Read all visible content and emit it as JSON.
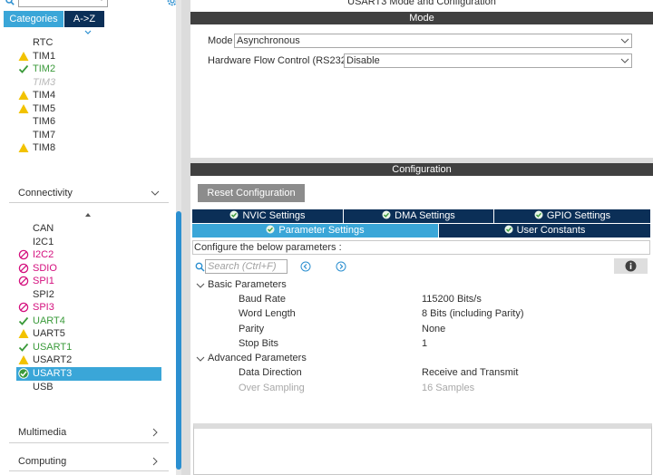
{
  "left": {
    "tabs": {
      "categories": "Categories",
      "az": "A->Z"
    },
    "timers": [
      {
        "label": "RTC",
        "status": "none"
      },
      {
        "label": "TIM1",
        "status": "warning"
      },
      {
        "label": "TIM2",
        "status": "ok"
      },
      {
        "label": "TIM3",
        "status": "disabled"
      },
      {
        "label": "TIM4",
        "status": "warning"
      },
      {
        "label": "TIM5",
        "status": "warning"
      },
      {
        "label": "TIM6",
        "status": "none"
      },
      {
        "label": "TIM7",
        "status": "none"
      },
      {
        "label": "TIM8",
        "status": "warning"
      }
    ],
    "connectivity": {
      "title": "Connectivity",
      "items": [
        {
          "label": "CAN",
          "status": "none"
        },
        {
          "label": "I2C1",
          "status": "none"
        },
        {
          "label": "I2C2",
          "status": "blocked"
        },
        {
          "label": "SDIO",
          "status": "blocked"
        },
        {
          "label": "SPI1",
          "status": "blocked"
        },
        {
          "label": "SPI2",
          "status": "none"
        },
        {
          "label": "SPI3",
          "status": "blocked"
        },
        {
          "label": "UART4",
          "status": "ok"
        },
        {
          "label": "UART5",
          "status": "warning"
        },
        {
          "label": "USART1",
          "status": "ok"
        },
        {
          "label": "USART2",
          "status": "warning"
        },
        {
          "label": "USART3",
          "status": "selected"
        },
        {
          "label": "USB",
          "status": "none"
        }
      ]
    },
    "multimedia": {
      "title": "Multimedia"
    },
    "computing": {
      "title": "Computing"
    }
  },
  "right": {
    "title": "USART3 Mode and Configuration",
    "mode_header": "Mode",
    "mode_label": "Mode",
    "mode_value": "Asynchronous",
    "hwflow_label": "Hardware Flow Control (RS232)",
    "hwflow_value": "Disable",
    "config_header": "Configuration",
    "reset_button": "Reset Configuration",
    "tabs": {
      "nvic": "NVIC Settings",
      "dma": "DMA Settings",
      "gpio": "GPIO Settings",
      "params": "Parameter Settings",
      "user": "User Constants"
    },
    "hint": "Configure the below parameters :",
    "search_placeholder": "Search (Ctrl+F)",
    "basic": {
      "title": "Basic Parameters",
      "rows": [
        {
          "name": "Baud Rate",
          "value": "115200 Bits/s"
        },
        {
          "name": "Word Length",
          "value": "8 Bits (including Parity)"
        },
        {
          "name": "Parity",
          "value": "None"
        },
        {
          "name": "Stop Bits",
          "value": "1"
        }
      ]
    },
    "advanced": {
      "title": "Advanced Parameters",
      "rows": [
        {
          "name": "Data Direction",
          "value": "Receive and Transmit"
        },
        {
          "name": "Over Sampling",
          "value": "16 Samples"
        }
      ]
    }
  },
  "colors": {
    "accent": "#3aa6d8",
    "navy": "#0b2f57",
    "ok": "#3a9a3a",
    "warning": "#f2c200",
    "blocked": "#d4107e"
  }
}
